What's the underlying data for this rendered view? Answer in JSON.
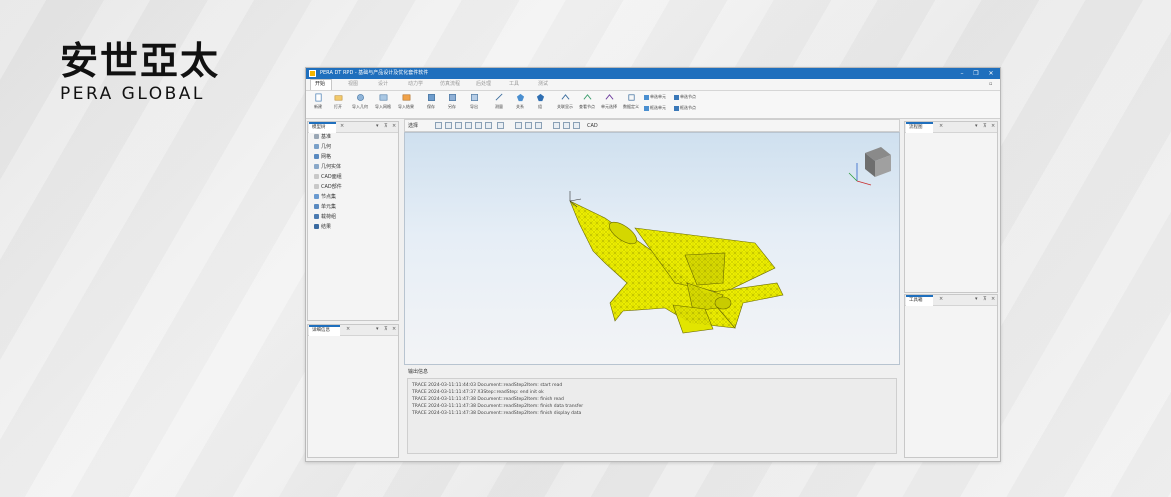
{
  "brand": {
    "name_cn": "安世亞太",
    "name_en": "PERA GLOBAL"
  },
  "window": {
    "title": "PERA DT RPD - 基础与产品设计及优化套件软件"
  },
  "menu": {
    "tabs": [
      "开始",
      "视图",
      "设计",
      "动力学",
      "仿真流程",
      "后处理",
      "工具",
      "测试"
    ]
  },
  "toolbar": {
    "tools": [
      "新建",
      "打开",
      "导入几何",
      "导入网格",
      "导入结果",
      "保存",
      "另存",
      "导出",
      "测量",
      "关系",
      "组",
      "关联显示",
      "查看节点",
      "单元选择",
      "数据定义"
    ],
    "small_tools": [
      "单选单元",
      "框选单元",
      "单选节点",
      "框选节点"
    ]
  },
  "model_tree": {
    "title": "模型树",
    "items": [
      "基准",
      "几何",
      "网格",
      "几何实体",
      "CAD面组",
      "CAD部件",
      "节点集",
      "单元集",
      "载荷组",
      "结果"
    ]
  },
  "details_panel": {
    "title": "详细信息"
  },
  "flow_panel": {
    "title": "流程图"
  },
  "tools_panel": {
    "title": "工具箱"
  },
  "viewport": {
    "toolbar_left_label": "选择",
    "toolbar_right_label": "CAD",
    "model_color": "#eef000",
    "mesh_color": "#6b6b00",
    "bg_top": "#cfe0ef",
    "bg_bottom": "#f3f4f6"
  },
  "output": {
    "title": "输出信息",
    "lines": [
      "TRACE 2024-03-11:11:44:03 Document::readStep2Item: start read",
      "TRACE 2024-03-11:11:47:37 X3Step::readStep: end init ok",
      "TRACE 2024-03-11:11:47:38 Document::readStep2Item: finish read",
      "TRACE 2024-03-11:11:47:38 Document::readStep2Item: finish data transfer",
      "TRACE 2024-03-11:11:47:38 Document::readStep2Item: finish display data"
    ]
  },
  "colors": {
    "accent": "#1f6fbd"
  }
}
